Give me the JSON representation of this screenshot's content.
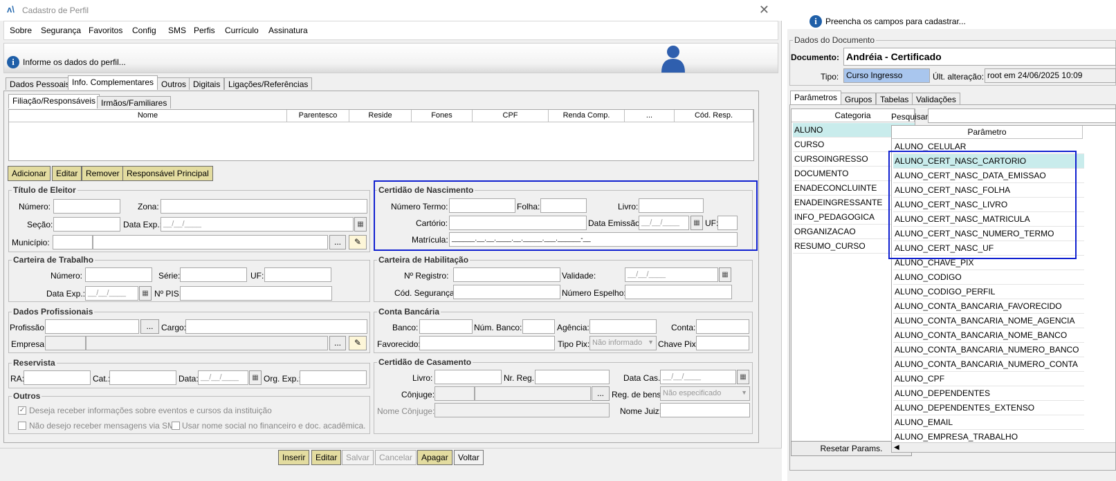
{
  "window": {
    "title": "Cadastro de Perfil",
    "close": "✕"
  },
  "menu": [
    "Sobre",
    "Segurança",
    "Favoritos",
    "Config",
    "SMS",
    "Perfis",
    "Currículo",
    "Assinatura"
  ],
  "info": {
    "message": "Informe os dados do perfil..."
  },
  "tabs": [
    "Dados Pessoais",
    "Info. Complementares",
    "Outros",
    "Digitais",
    "Ligações/Referências"
  ],
  "subtabs": [
    "Filiação/Responsáveis",
    "Irmãos/Familiares"
  ],
  "grid_headers": [
    "Nome",
    "Parentesco",
    "Reside",
    "Fones",
    "CPF",
    "Renda Comp.",
    "...",
    "Cód. Resp."
  ],
  "grid_buttons": [
    "Adicionar",
    "Editar",
    "Remover",
    "Responsável Principal"
  ],
  "titulo": {
    "title": "Título de Eleitor",
    "numero": "Número:",
    "zona": "Zona:",
    "secao": "Seção:",
    "data_exp": "Data Exp.:",
    "municipio": "Município:",
    "date_mask": "__/__/____",
    "ellipsis": "..."
  },
  "certidao": {
    "title": "Certidão de Nascimento",
    "numero_termo": "Número Termo:",
    "folha": "Folha:",
    "livro": "Livro:",
    "cartorio": "Cartório:",
    "data_emissao": "Data Emissão:",
    "uf": "UF:",
    "matricula": "Matrícula:",
    "date_mask": "__/__/____",
    "matricula_mask": "______.__.__.____.__._____.___.______-__"
  },
  "carteira_trabalho": {
    "title": "Carteira de Trabalho",
    "numero": "Número:",
    "serie": "Série:",
    "uf": "UF:",
    "data_exp": "Data Exp.:",
    "pis": "Nº PIS:",
    "date_mask": "__/__/____"
  },
  "carteira_hab": {
    "title": "Carteira de Habilitação",
    "registro": "Nº Registro:",
    "validade": "Validade:",
    "cod_seg": "Cód. Segurança:",
    "espelho": "Número Espelho:",
    "date_mask": "__/__/____"
  },
  "dados_prof": {
    "title": "Dados Profissionais",
    "profissao": "Profissão:",
    "cargo": "Cargo:",
    "empresa": "Empresa:",
    "ellipsis": "..."
  },
  "conta": {
    "title": "Conta Bancária",
    "banco": "Banco:",
    "num_banco": "Núm. Banco:",
    "agencia": "Agência:",
    "conta": "Conta:",
    "favorecido": "Favorecido:",
    "tipo_pix": "Tipo Pix:",
    "tipo_pix_value": "Não informado",
    "chave_pix": "Chave Pix:"
  },
  "reservista": {
    "title": "Reservista",
    "ra": "RA:",
    "cat": "Cat.:",
    "data": "Data:",
    "org": "Org. Exp.:",
    "date_mask": "__/__/____"
  },
  "casamento": {
    "title": "Certidão de Casamento",
    "livro": "Livro:",
    "nr_reg": "Nr. Reg.:",
    "data_cas": "Data Cas.:",
    "conjuge": "Cônjuge:",
    "reg_bens": "Reg. de bens:",
    "reg_bens_value": "Não especificado",
    "nome_conjuge": "Nome Cônjuge:",
    "nome_juiz": "Nome Juiz:",
    "date_mask": "__/__/____",
    "ellipsis": "..."
  },
  "outros": {
    "title": "Outros",
    "opt1": "Deseja receber informações sobre eventos e cursos da instituição",
    "opt2": "Não desejo receber mensagens via SMS",
    "opt3": "Usar nome social no financeiro e doc. acadêmica.",
    "check": "✓"
  },
  "footer": [
    "Inserir",
    "Editar",
    "Salvar",
    "Cancelar",
    "Apagar",
    "Voltar"
  ],
  "right": {
    "info": "Preencha os campos para cadastrar...",
    "doc_title": "Dados do Documento",
    "documento_label": "Documento:",
    "documento_value": "Andréia - Certificado",
    "tipo_label": "Tipo:",
    "tipo_value": "Curso Ingresso",
    "ult_label": "Últ. alteração:",
    "ult_value": "root em 24/06/2025 10:09",
    "tabs": [
      "Parâmetros",
      "Grupos",
      "Tabelas",
      "Validações"
    ],
    "cat_header": "Categoria",
    "categories": [
      "ALUNO",
      "CURSO",
      "CURSOINGRESSO",
      "DOCUMENTO",
      "ENADECONCLUINTE",
      "ENADEINGRESSANTE",
      "INFO_PEDAGOGICA",
      "ORGANIZACAO",
      "RESUMO_CURSO"
    ],
    "search_label": "Pesquisar:",
    "param_header": "Parâmetro",
    "params": [
      "ALUNO_CELULAR",
      "ALUNO_CERT_NASC_CARTORIO",
      "ALUNO_CERT_NASC_DATA_EMISSAO",
      "ALUNO_CERT_NASC_FOLHA",
      "ALUNO_CERT_NASC_LIVRO",
      "ALUNO_CERT_NASC_MATRICULA",
      "ALUNO_CERT_NASC_NUMERO_TERMO",
      "ALUNO_CERT_NASC_UF",
      "ALUNO_CHAVE_PIX",
      "ALUNO_CODIGO",
      "ALUNO_CODIGO_PERFIL",
      "ALUNO_CONTA_BANCARIA_FAVORECIDO",
      "ALUNO_CONTA_BANCARIA_NOME_AGENCIA",
      "ALUNO_CONTA_BANCARIA_NOME_BANCO",
      "ALUNO_CONTA_BANCARIA_NUMERO_BANCO",
      "ALUNO_CONTA_BANCARIA_NUMERO_CONTA",
      "ALUNO_CPF",
      "ALUNO_DEPENDENTES",
      "ALUNO_DEPENDENTES_EXTENSO",
      "ALUNO_EMAIL",
      "ALUNO_EMPRESA_TRABALHO"
    ],
    "reset": "Resetar Params."
  },
  "colors": {
    "highlight_box": "#1020d0",
    "selected_row": "#c9ecec",
    "yellow_button": "#e3dca0",
    "tipo_bg": "#a9c6ee"
  }
}
